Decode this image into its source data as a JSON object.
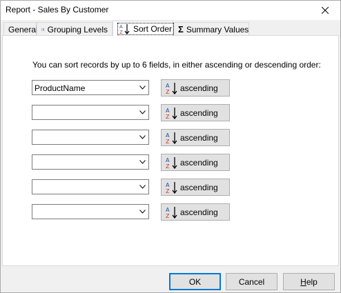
{
  "window": {
    "title": "Report - Sales By Customer"
  },
  "tabs": [
    {
      "label": "General",
      "icon": "none"
    },
    {
      "label": "Grouping Levels",
      "icon": "grouping-levels-icon"
    },
    {
      "label": "Sort Order",
      "icon": "sort-az-icon",
      "active": true
    },
    {
      "label": "Summary Values",
      "icon": "sigma-icon"
    }
  ],
  "sort_page": {
    "instruction": "You can sort records by up to 6 fields, in either ascending or descending order:",
    "rows": [
      {
        "field": "ProductName",
        "direction": "ascending"
      },
      {
        "field": "",
        "direction": "ascending"
      },
      {
        "field": "",
        "direction": "ascending"
      },
      {
        "field": "",
        "direction": "ascending"
      },
      {
        "field": "",
        "direction": "ascending"
      },
      {
        "field": "",
        "direction": "ascending"
      }
    ]
  },
  "footer": {
    "ok_label": "OK",
    "cancel_label": "Cancel",
    "help_prefix": "",
    "help_mnemonic": "H",
    "help_rest": "elp"
  },
  "colors": {
    "accent": "#0078d7",
    "icon_blue": "#1a4fa0",
    "icon_red": "#c0392b"
  }
}
